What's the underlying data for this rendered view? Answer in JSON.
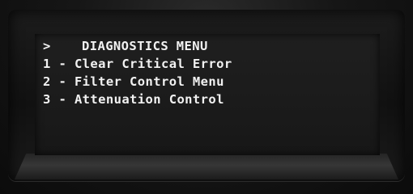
{
  "menu": {
    "cursor": ">",
    "title": "DIAGNOSTICS MENU",
    "items": [
      {
        "number": "1",
        "separator": "-",
        "label": "Clear Critical Error"
      },
      {
        "number": "2",
        "separator": "-",
        "label": "Filter Control Menu"
      },
      {
        "number": "3",
        "separator": "-",
        "label": "Attenuation Control"
      }
    ]
  },
  "colors": {
    "text": "#f2f2f2",
    "screen": "#1c1c1c",
    "bezel": "#111111"
  }
}
